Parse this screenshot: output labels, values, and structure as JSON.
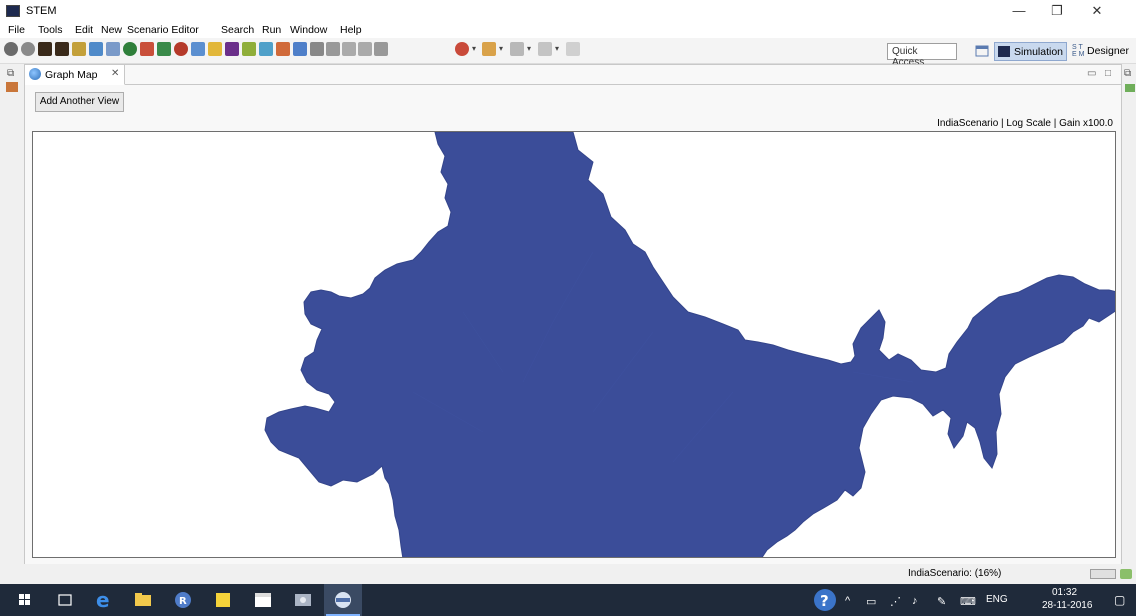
{
  "window": {
    "title": "STEM",
    "minimize": "—",
    "maximize": "❐",
    "close": "✕"
  },
  "menu": [
    "File",
    "Tools",
    "Edit",
    "New",
    "Scenario Editor",
    "Search",
    "Run",
    "Window",
    "Help"
  ],
  "toolbar": {
    "quick_access": "Quick Access",
    "perspectives": {
      "simulation": "Simulation",
      "designer": "Designer",
      "designer_mark": "S T\nE M"
    }
  },
  "view": {
    "tab_label": "Graph Map",
    "tab_close": "✕",
    "minimize": "▭",
    "maximize": "□",
    "add_view_button": "Add Another View",
    "scenario_info": "IndiaScenario | Log Scale | Gain x100.0",
    "map_color": "#3b4d99"
  },
  "status": {
    "text": "IndiaScenario: (16%)"
  },
  "taskbar": {
    "language": "ENG",
    "time": "01:32",
    "date": "28-11-2016"
  }
}
